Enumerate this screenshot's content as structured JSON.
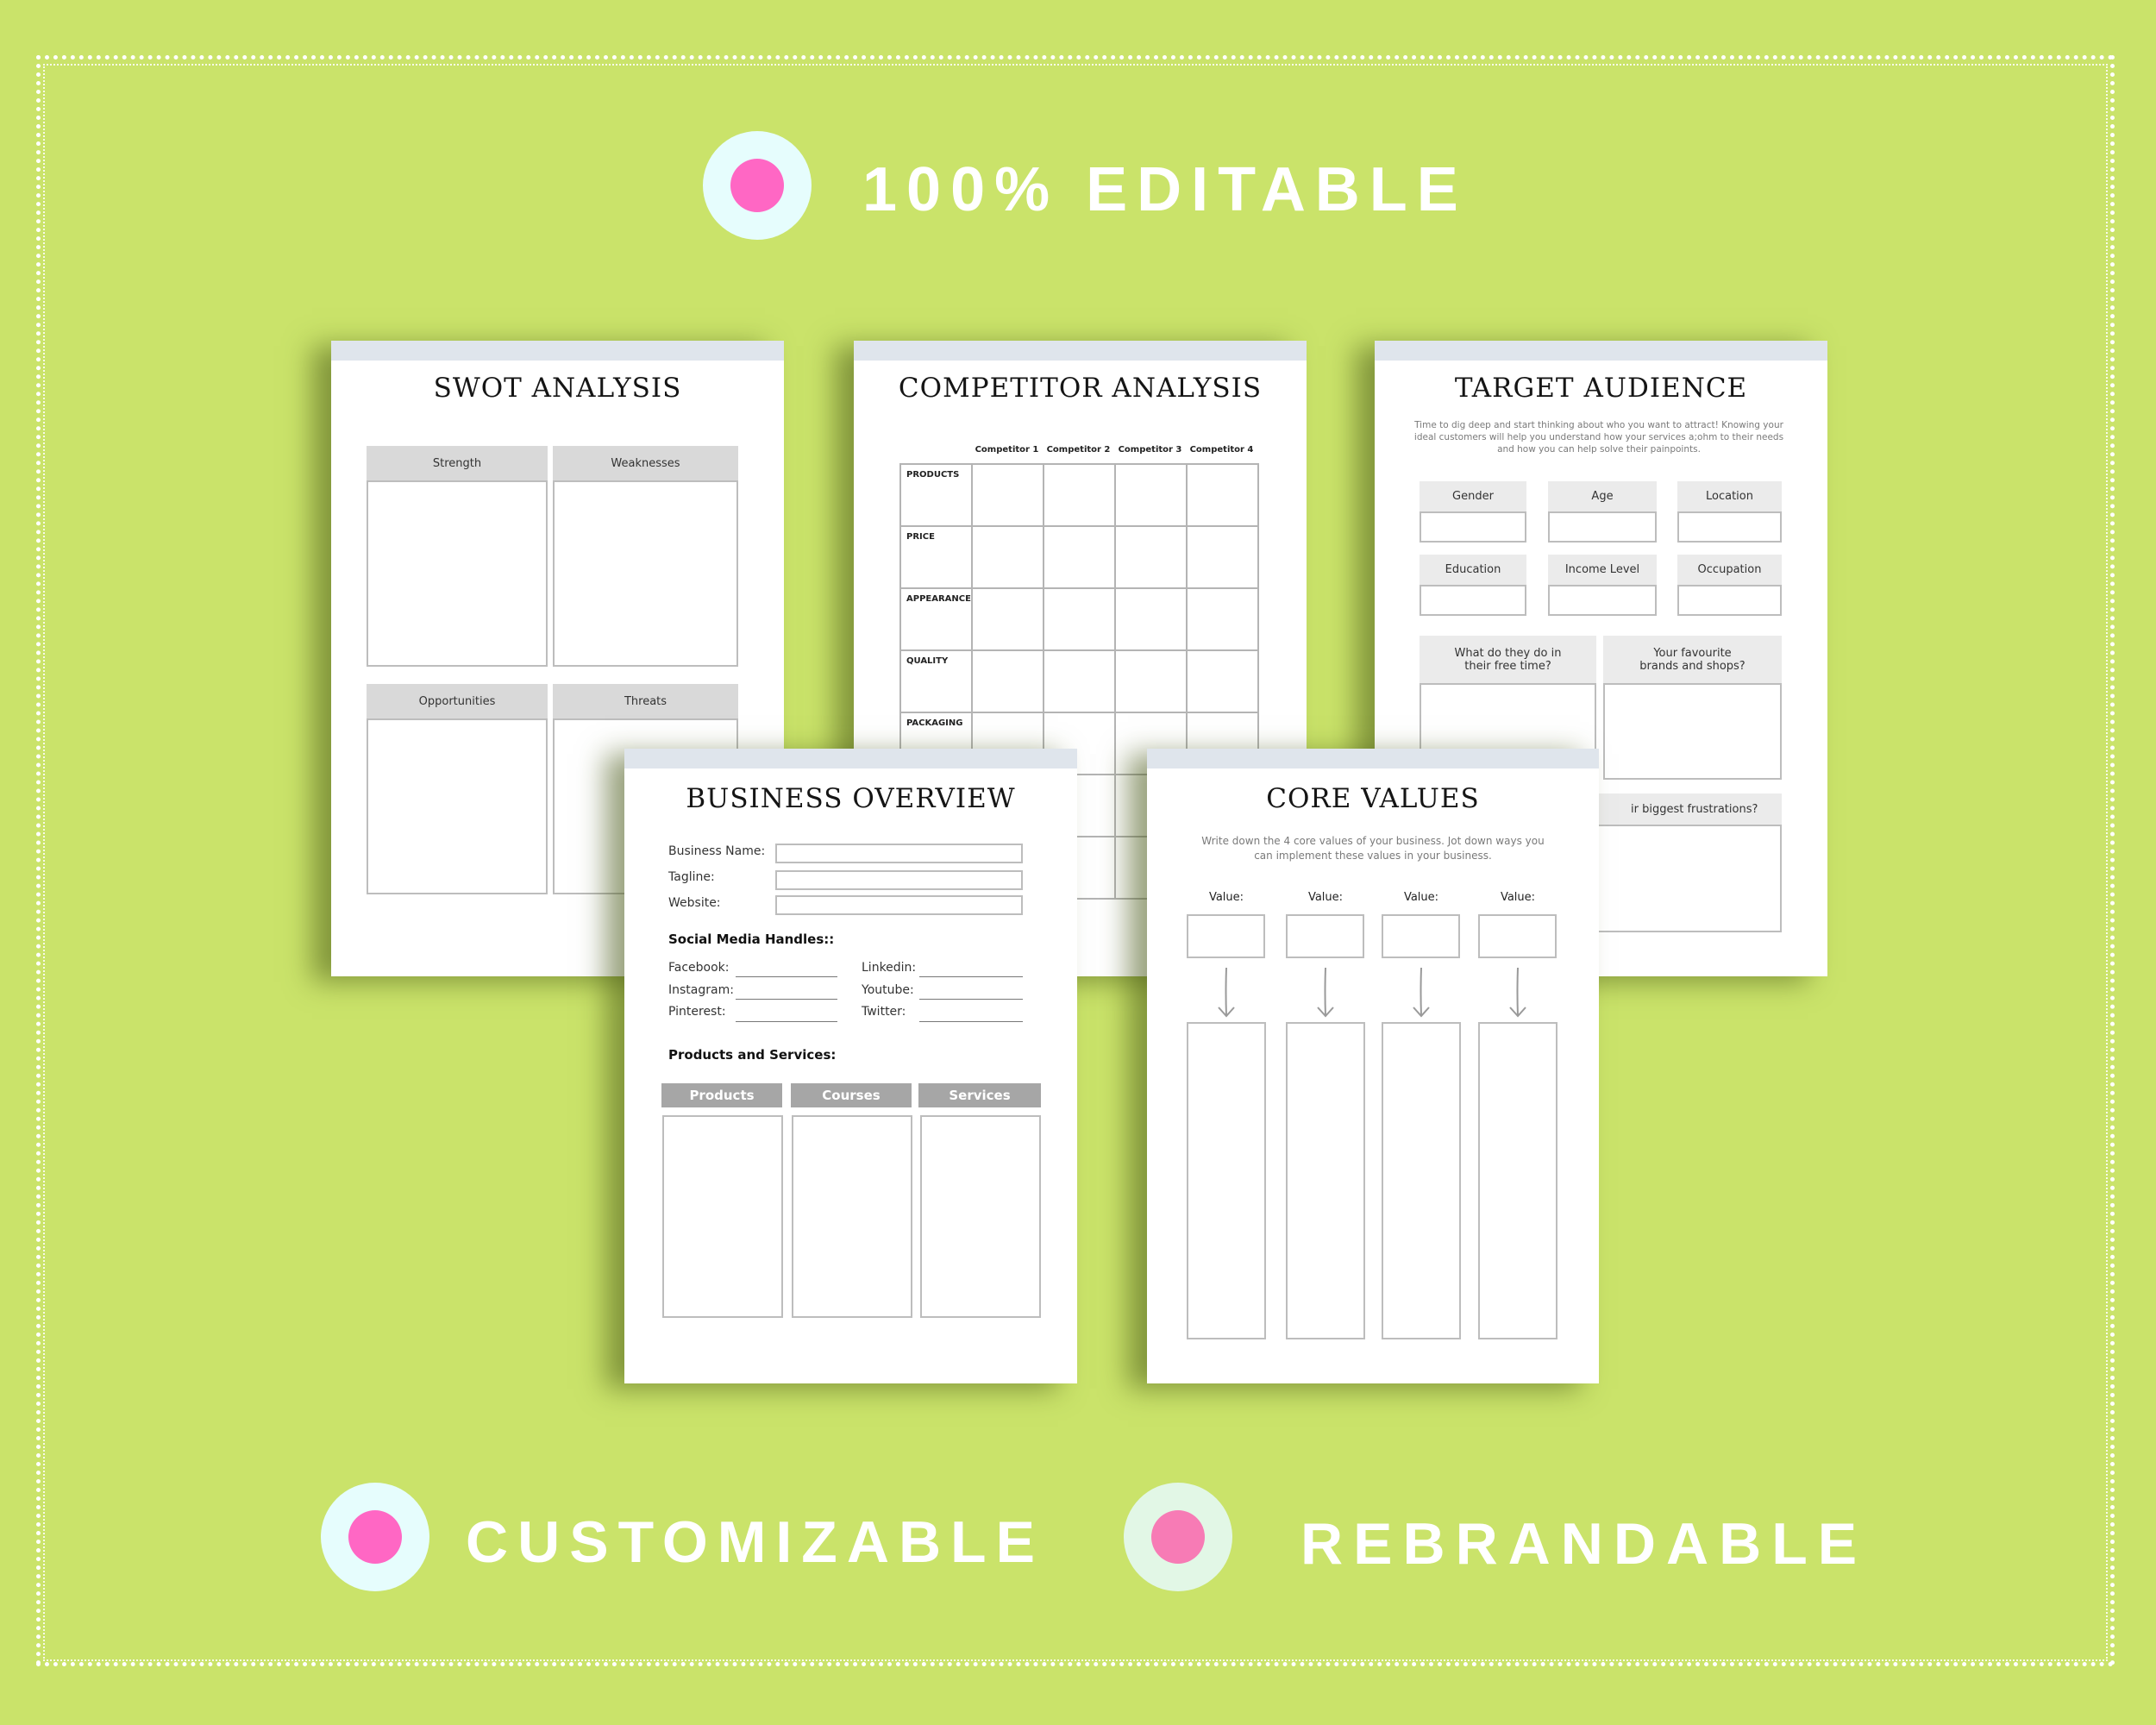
{
  "colors": {
    "background": "#cae36a",
    "badge_outer_cyan": "#e6fdfd",
    "badge_outer_mint": "#e2f7e6",
    "badge_pink": "#ff67c4",
    "badge_pink_soft": "#f77bb5",
    "page_band": "#dfe5ec"
  },
  "features": {
    "top": "100% EDITABLE",
    "bottom_left": "CUSTOMIZABLE",
    "bottom_right": "REBRANDABLE"
  },
  "pages": {
    "swot": {
      "title": "SWOT ANALYSIS",
      "quadrants": [
        "Strength",
        "Weaknesses",
        "Opportunities",
        "Threats"
      ]
    },
    "competitor": {
      "title": "COMPETITOR ANALYSIS",
      "columns": [
        "Competitor 1",
        "Competitor 2",
        "Competitor 3",
        "Competitor 4"
      ],
      "rows": [
        "PRODUCTS",
        "PRICE",
        "APPEARANCE",
        "QUALITY",
        "PACKAGING",
        "",
        ""
      ]
    },
    "target": {
      "title": "TARGET AUDIENCE",
      "intro": "Time to dig deep and start thinking about who you want to attract! Knowing your ideal customers will help you understand how your services a;ohm to their needs and how you can help solve their painpoints.",
      "fields": [
        "Gender",
        "Age",
        "Location",
        "Education",
        "Income Level",
        "Occupation"
      ],
      "questions": [
        "What do they do in their free time?",
        "Your favourite brands and shops?"
      ],
      "frustrations": "ir biggest frustrations?"
    },
    "business": {
      "title": "BUSINESS OVERVIEW",
      "fields": [
        "Business Name:",
        "Tagline:",
        "Website:"
      ],
      "social_heading": "Social Media Handles::",
      "social_left": [
        "Facebook:",
        "Instagram:",
        "Pinterest:"
      ],
      "social_right": [
        "Linkedin:",
        "Youtube:",
        "Twitter:"
      ],
      "products_heading": "Products and Services:",
      "columns": [
        "Products",
        "Courses",
        "Services"
      ]
    },
    "core": {
      "title": "CORE VALUES",
      "intro": "Write down the 4 core values of your business. Jot down ways you can implement these values in your business.",
      "value_label": "Value:"
    }
  }
}
